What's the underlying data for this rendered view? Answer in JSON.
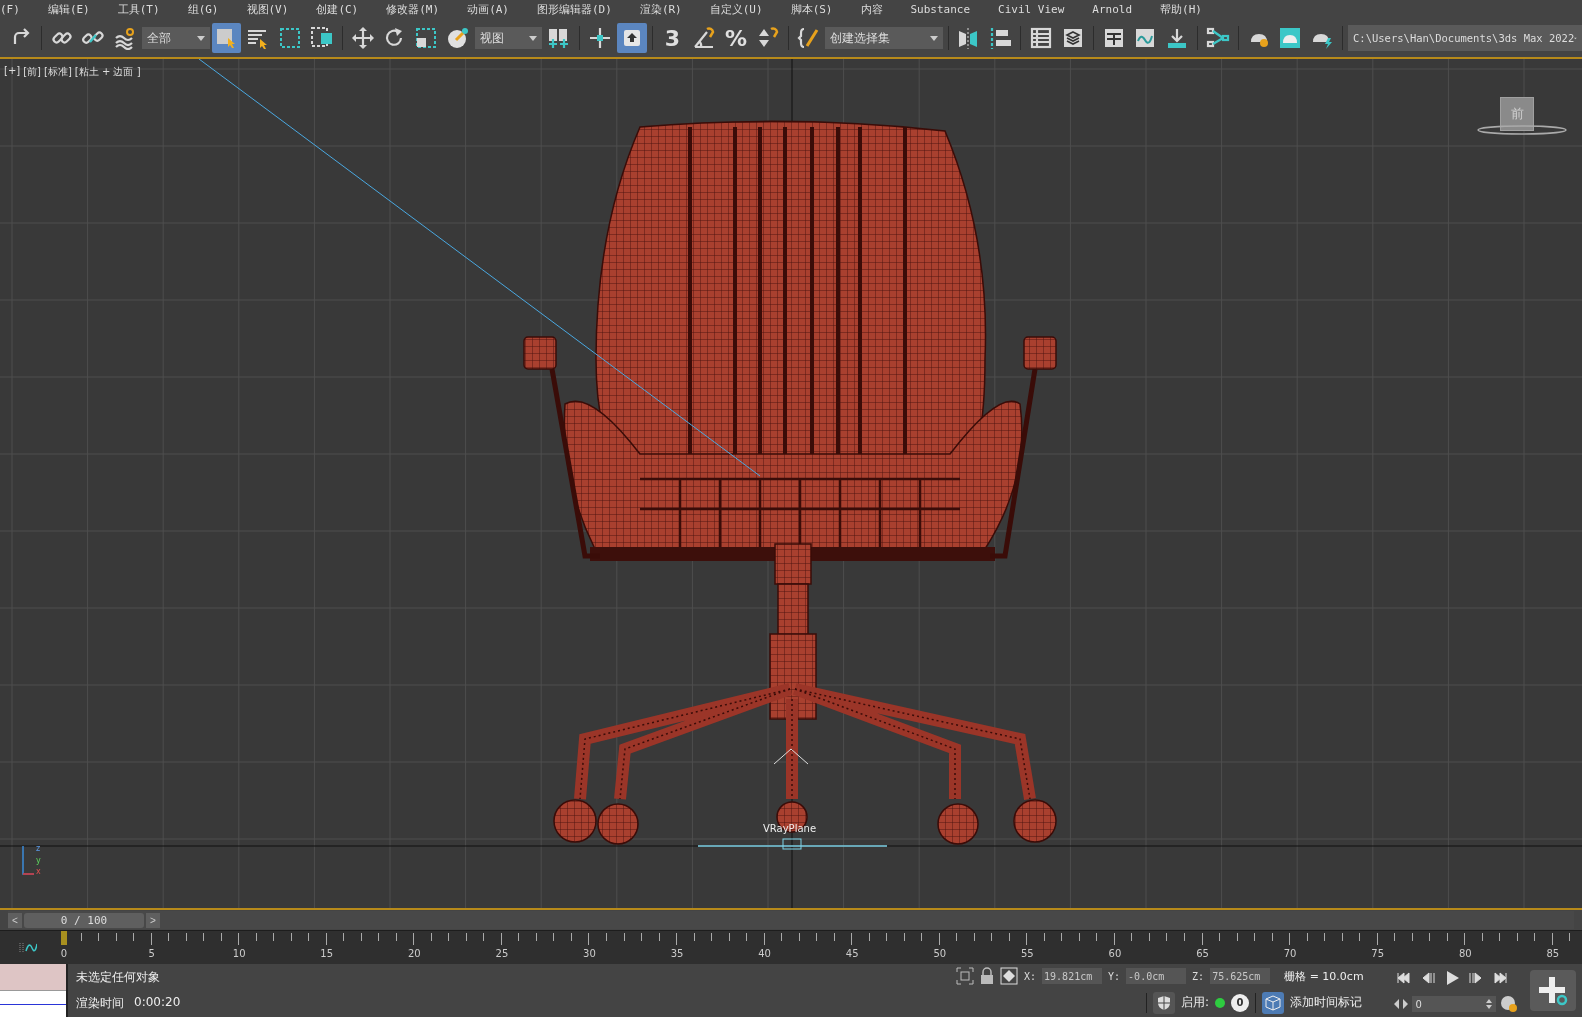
{
  "menu": [
    "(F)",
    "编辑(E)",
    "工具(T)",
    "组(G)",
    "视图(V)",
    "创建(C)",
    "修改器(M)",
    "动画(A)",
    "图形编辑器(D)",
    "渲染(R)",
    "自定义(U)",
    "脚本(S)",
    "内容",
    "Substance",
    "Civil View",
    "Arnold",
    "帮助(H)"
  ],
  "toolbar": [
    {
      "kind": "button",
      "selected": false
    },
    {
      "kind": "sep"
    },
    {
      "kind": "button",
      "selected": false
    },
    {
      "kind": "button",
      "selected": false
    },
    {
      "kind": "button",
      "selected": false
    },
    {
      "kind": "dropdown",
      "value": "全部"
    },
    {
      "kind": "button",
      "selected": true
    },
    {
      "kind": "button",
      "selected": false
    },
    {
      "kind": "button",
      "selected": false
    },
    {
      "kind": "button",
      "selected": false
    },
    {
      "kind": "sep"
    },
    {
      "kind": "button",
      "selected": false
    },
    {
      "kind": "button",
      "selected": false
    },
    {
      "kind": "button",
      "selected": false
    },
    {
      "kind": "button",
      "selected": false
    },
    {
      "kind": "dropdown",
      "value": "视图"
    },
    {
      "kind": "button",
      "selected": false
    },
    {
      "kind": "sep"
    },
    {
      "kind": "button",
      "selected": false
    },
    {
      "kind": "button",
      "selected": true
    },
    {
      "kind": "sep"
    },
    {
      "kind": "glyph",
      "text": "3",
      "selected": false
    },
    {
      "kind": "button",
      "selected": false
    },
    {
      "kind": "glyph",
      "text": "%",
      "selected": false
    },
    {
      "kind": "button",
      "selected": false
    },
    {
      "kind": "sep"
    },
    {
      "kind": "button",
      "selected": false
    },
    {
      "kind": "dropdown",
      "value": "创建选择集"
    },
    {
      "kind": "sep"
    },
    {
      "kind": "button",
      "selected": false
    },
    {
      "kind": "button",
      "selected": false
    },
    {
      "kind": "sep"
    },
    {
      "kind": "button",
      "selected": false
    },
    {
      "kind": "button",
      "selected": false
    },
    {
      "kind": "sep"
    },
    {
      "kind": "button",
      "selected": false
    },
    {
      "kind": "button",
      "selected": false
    },
    {
      "kind": "button",
      "selected": false
    },
    {
      "kind": "sep"
    },
    {
      "kind": "button",
      "selected": false
    },
    {
      "kind": "sep"
    },
    {
      "kind": "button",
      "selected": false
    },
    {
      "kind": "button",
      "selected": false
    },
    {
      "kind": "button",
      "selected": false
    },
    {
      "kind": "sep"
    },
    {
      "kind": "dropdown",
      "value": "C:\\Users\\Han\\Documents\\3ds Max 2022"
    }
  ],
  "viewport": {
    "labels": [
      "[+]",
      "[前]",
      "[标准]",
      "[粘土 + 边面 ]"
    ],
    "viewcube_face": "前",
    "object_label": "VRayPlane",
    "axis_labels": [
      "z",
      "y",
      "x"
    ]
  },
  "time_slider": {
    "value": "0 / 100",
    "prev": "<",
    "next": ">"
  },
  "ruler": {
    "labels": [
      "0",
      "5",
      "10",
      "15",
      "20",
      "25",
      "30",
      "35",
      "40",
      "45",
      "50",
      "55",
      "60",
      "65",
      "70",
      "75",
      "80",
      "85"
    ]
  },
  "status": {
    "message": "未选定任何对象",
    "render_time_label": "渲染时间",
    "render_time": "0:00:20",
    "coords": [
      {
        "axis": "X:",
        "value": "19.821cm"
      },
      {
        "axis": "Y:",
        "value": "-0.0cm"
      },
      {
        "axis": "Z:",
        "value": "75.625cm"
      }
    ],
    "grid": "栅格 = 10.0cm",
    "enable_label": "启用:",
    "enable_count": "0",
    "add_time_tag": "添加时间标记",
    "frame": "0"
  }
}
